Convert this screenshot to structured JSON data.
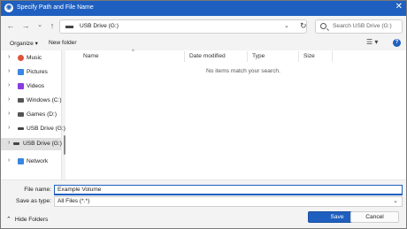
{
  "window": {
    "title": "Specify Path and File Name",
    "close_glyph": "✕"
  },
  "nav": {
    "back_glyph": "←",
    "forward_glyph": "→",
    "up_glyph": "↑",
    "address": "USB Drive (G:)",
    "chevron_glyph": "⌄",
    "refresh_glyph": "↻",
    "search_placeholder": "Search USB Drive (G:)"
  },
  "toolbar": {
    "organize": "Organize ▾",
    "new_folder": "New folder",
    "view_glyph": "☰ ▾",
    "help_glyph": "?"
  },
  "sidebar": {
    "items": [
      {
        "label": "Music",
        "icon": "music-icon",
        "color": "#e0523a",
        "expand": "›"
      },
      {
        "label": "Pictures",
        "icon": "pictures-icon",
        "color": "#3a86e0",
        "expand": "›"
      },
      {
        "label": "Videos",
        "icon": "videos-icon",
        "color": "#8a3ae0",
        "expand": "›"
      },
      {
        "label": "Windows (C:)",
        "icon": "drive-icon",
        "color": "#555555",
        "expand": "›"
      },
      {
        "label": "Games (D:)",
        "icon": "drive-icon",
        "color": "#555555",
        "expand": "›"
      },
      {
        "label": "USB Drive (G:)",
        "icon": "usb-drive-icon",
        "color": "#444444",
        "expand": "›"
      },
      {
        "label": "USB Drive (G:)",
        "icon": "usb-drive-icon",
        "color": "#444444",
        "expand": "›",
        "selected": true
      },
      {
        "label": "Network",
        "icon": "network-icon",
        "color": "#3a86e0",
        "expand": "›"
      }
    ]
  },
  "columns": {
    "name": "Name",
    "date_modified": "Date modified",
    "type": "Type",
    "size": "Size",
    "sort_glyph": "^"
  },
  "empty_message": "No items match your search.",
  "footer": {
    "file_name_label": "File name:",
    "file_name_value": "Example Volume",
    "save_as_type_label": "Save as type:",
    "save_as_type_value": "All Files (*.*)",
    "hide_folders": "Hide Folders",
    "hide_chevron": "⌃",
    "select_chevron": "⌄",
    "save_label": "Save",
    "cancel_label": "Cancel"
  },
  "colors": {
    "accent": "#1f5fbf"
  }
}
